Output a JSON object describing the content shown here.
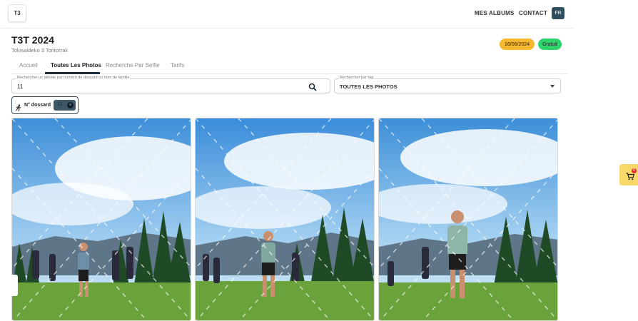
{
  "header": {
    "logo_text": "T3",
    "nav": [
      {
        "label": "MES ALBUMS"
      },
      {
        "label": "CONTACT"
      }
    ],
    "language": "FR"
  },
  "event": {
    "title": "T3T 2024",
    "subtitle": "Tolosaldeko 3 Tontorrak",
    "date_badge": "16/06/2024",
    "price_badge": "Gratuit"
  },
  "tabs": [
    {
      "label": "Accueil",
      "active": false
    },
    {
      "label": "Toutes Les Photos",
      "active": true
    },
    {
      "label": "Recherche Par Selfie",
      "active": false
    },
    {
      "label": "Tarifs",
      "active": false
    }
  ],
  "search": {
    "label": "Rechercher un athlète par numéro de dossard ou nom de famille",
    "value": "11"
  },
  "tag_filter": {
    "label": "Rechercher par tag",
    "value": "TOUTES LES PHOTOS"
  },
  "filter_chip": {
    "label": "N° dossard",
    "value": "11"
  },
  "photos": [
    {
      "name": "photo-1"
    },
    {
      "name": "photo-2"
    },
    {
      "name": "photo-3"
    }
  ],
  "cart": {
    "count": "0"
  },
  "icons": {
    "search": "search-icon",
    "runner": "runner-icon",
    "close": "close-icon",
    "cart": "cart-icon",
    "dropdown": "chevron-down-icon"
  },
  "colors": {
    "date_badge": "#f5b82e",
    "price_badge": "#2fd36b",
    "accent": "#1e2d3a",
    "cart": "#f7d96a"
  }
}
